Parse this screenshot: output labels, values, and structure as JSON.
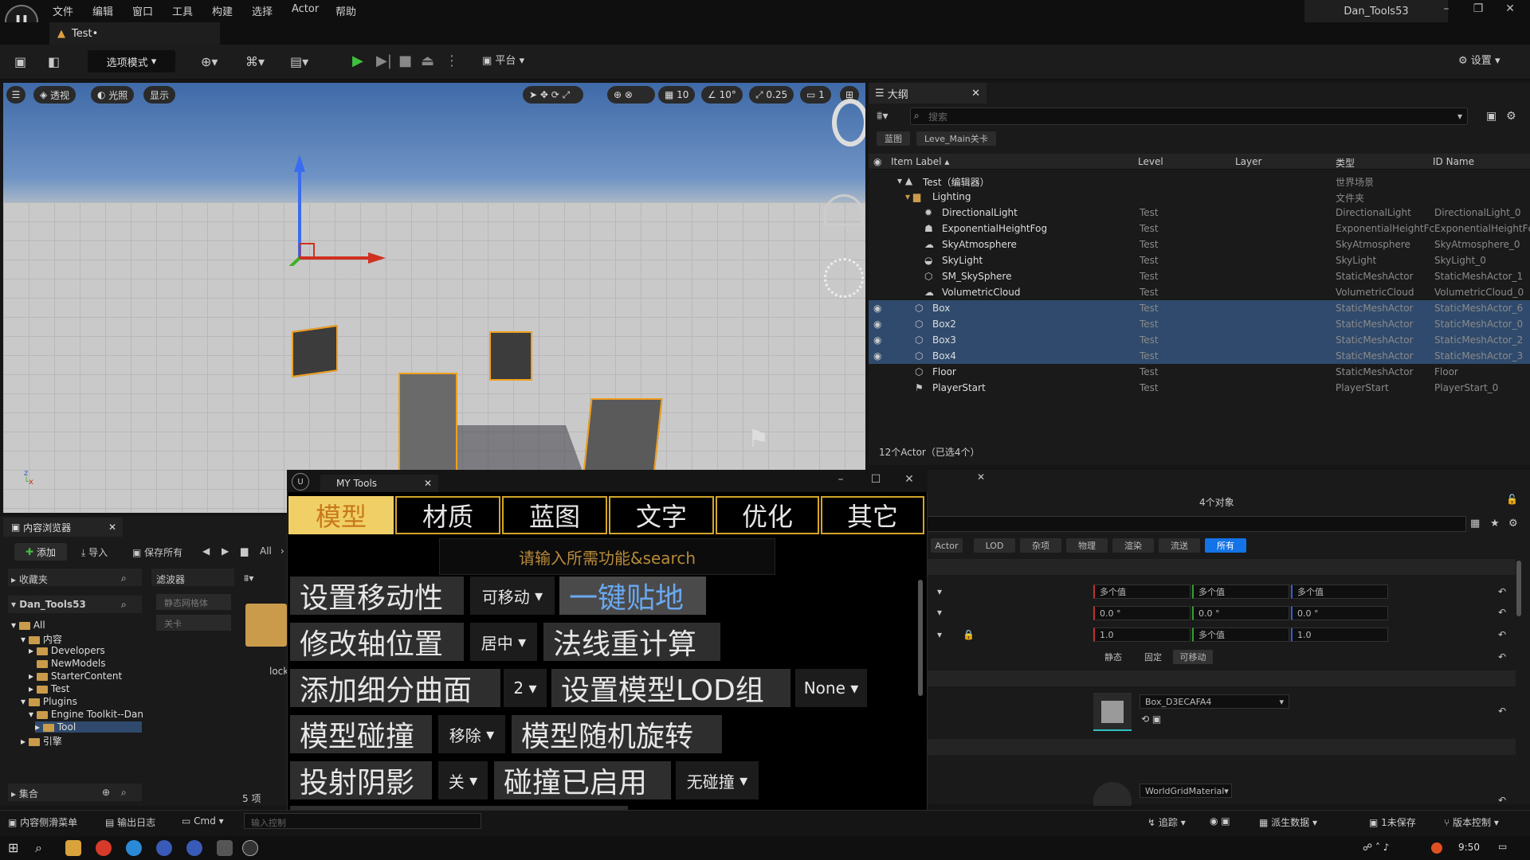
{
  "menu": {
    "items": [
      "文件",
      "编辑",
      "窗口",
      "工具",
      "构建",
      "选择",
      "Actor",
      "帮助"
    ],
    "project": "Dan_Tools53"
  },
  "doc_tab": "Test•",
  "toolbar": {
    "mode": "选项模式",
    "platform": "平台",
    "settings": "设置"
  },
  "viewport": {
    "perspective": "透视",
    "lit": "光照",
    "show": "显示",
    "grid": "10",
    "angle": "10°",
    "scale": "0.25",
    "camera": "1"
  },
  "outliner": {
    "tab": "大纲",
    "search_placeholder": "搜索",
    "chips": [
      "蓝图",
      "Leve_Main关卡"
    ],
    "columns": [
      "Item Label ▴",
      "Level",
      "Layer",
      "类型",
      "ID Name"
    ],
    "rows": [
      {
        "name": "Test（编辑器）",
        "level": "",
        "type": "世界场景",
        "id": ""
      },
      {
        "name": "Lighting",
        "level": "",
        "type": "文件夹",
        "id": ""
      },
      {
        "name": "DirectionalLight",
        "level": "Test",
        "type": "DirectionalLight",
        "id": "DirectionalLight_0"
      },
      {
        "name": "ExponentialHeightFog",
        "level": "Test",
        "type": "ExponentialHeightFc",
        "id": "ExponentialHeightFc"
      },
      {
        "name": "SkyAtmosphere",
        "level": "Test",
        "type": "SkyAtmosphere",
        "id": "SkyAtmosphere_0"
      },
      {
        "name": "SkyLight",
        "level": "Test",
        "type": "SkyLight",
        "id": "SkyLight_0"
      },
      {
        "name": "SM_SkySphere",
        "level": "Test",
        "type": "StaticMeshActor",
        "id": "StaticMeshActor_1"
      },
      {
        "name": "VolumetricCloud",
        "level": "Test",
        "type": "VolumetricCloud",
        "id": "VolumetricCloud_0"
      },
      {
        "name": "Box",
        "level": "Test",
        "type": "StaticMeshActor",
        "id": "StaticMeshActor_6"
      },
      {
        "name": "Box2",
        "level": "Test",
        "type": "StaticMeshActor",
        "id": "StaticMeshActor_0"
      },
      {
        "name": "Box3",
        "level": "Test",
        "type": "StaticMeshActor",
        "id": "StaticMeshActor_2"
      },
      {
        "name": "Box4",
        "level": "Test",
        "type": "StaticMeshActor",
        "id": "StaticMeshActor_3"
      },
      {
        "name": "Floor",
        "level": "Test",
        "type": "StaticMeshActor",
        "id": "Floor"
      },
      {
        "name": "PlayerStart",
        "level": "Test",
        "type": "PlayerStart",
        "id": "PlayerStart_0"
      }
    ],
    "status": "12个Actor（已选4个）"
  },
  "details": {
    "count": "4个对象",
    "tabs": [
      "Actor",
      "LOD",
      "杂项",
      "物理",
      "渲染",
      "流送",
      "所有"
    ],
    "location": [
      "多个值",
      "多个值",
      "多个值"
    ],
    "rotation": [
      "0.0 °",
      "0.0 °",
      "0.0 °"
    ],
    "scale": [
      "1.0",
      "多个值",
      "1.0"
    ],
    "mobility": [
      "静态",
      "固定",
      "可移动"
    ],
    "mesh": "Box_D3ECAFA4",
    "material": "WorldGridMaterial"
  },
  "content": {
    "tab": "内容浏览器",
    "add": "添加",
    "import": "导入",
    "save_all": "保存所有",
    "path": "All",
    "favorites": "收藏夹",
    "project": "Dan_Tools53",
    "filters": "滤波器",
    "filter_items": [
      "静态网格体",
      "关卡"
    ],
    "tree": [
      "All",
      "内容",
      "Developers",
      "NewModels",
      "StarterContent",
      "Test",
      "Plugins",
      "Engine Toolkit--Dan",
      "Tool",
      "引擎"
    ],
    "collections": "集合",
    "count": "5 项",
    "asset_label": "lock"
  },
  "statusbar": {
    "drawer": "内容侧滑菜单",
    "log": "输出日志",
    "cmd": "Cmd",
    "cmd_placeholder": "输入控制",
    "trace": "追踪",
    "derived": "派生数据",
    "unsaved": "1未保存",
    "vcs": "版本控制"
  },
  "taskbar": {
    "time": "9:50"
  },
  "mytools": {
    "title": "MY Tools",
    "categories": [
      "模型",
      "材质",
      "蓝图",
      "文字",
      "优化",
      "其它"
    ],
    "search": "请输入所需功能&search",
    "rows": [
      {
        "btn": "设置移动性",
        "sel": "可移动",
        "btn2": "一键贴地"
      },
      {
        "btn": "修改轴位置",
        "sel": "居中",
        "btn2": "法线重计算"
      },
      {
        "btn": "添加细分曲面",
        "sel": "2",
        "btn2": "设置模型LOD组",
        "sel2": "None"
      },
      {
        "btn": "模型碰撞",
        "sel": "移除",
        "btn2": "模型随机旋转"
      },
      {
        "btn": "投射阴影",
        "sel": "关",
        "btn2": "碰撞已启用",
        "sel2": "无碰撞"
      }
    ]
  }
}
